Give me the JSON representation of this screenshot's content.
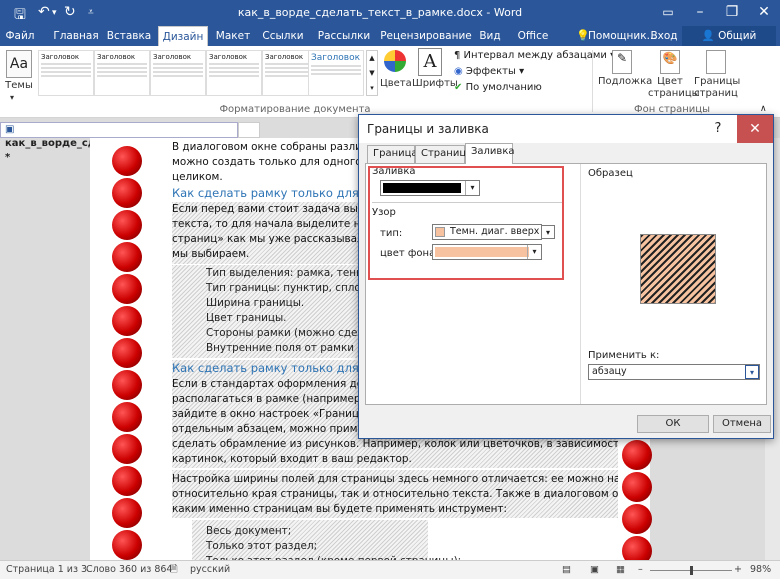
{
  "window": {
    "title": "как_в_ворде_сделать_текст_в_рамке.docx - Word"
  },
  "quick_access": {
    "save_icon": "save-icon",
    "undo_icon": "undo-icon",
    "redo_icon": "redo-icon"
  },
  "tabs": [
    "Файл",
    "Главная",
    "Вставка",
    "Дизайн",
    "Макет",
    "Ссылки",
    "Рассылки",
    "Рецензирование",
    "Вид",
    "Office Tab"
  ],
  "tab_active": "Дизайн",
  "tell_me": "Помощник...",
  "signin": "Вход",
  "share": "Общий доступ",
  "ribbon": {
    "themes_label": "Темы",
    "style_thumbs": [
      {
        "title": "Заголовок"
      },
      {
        "title": "Заголовок"
      },
      {
        "title": "Заголовок"
      },
      {
        "title": "Заголовок"
      },
      {
        "title": "Заголовок"
      },
      {
        "title": "Заголовок"
      }
    ],
    "colors_label": "Цвета",
    "fonts_label": "Шрифты",
    "paragraph_spacing": "Интервал между абзацами",
    "effects": "Эффекты",
    "set_default": "По умолчанию",
    "group_format": "Форматирование документа",
    "watermark": "Подложка",
    "page_color": "Цвет страницы",
    "page_borders": "Границы страниц",
    "group_background": "Фон страницы"
  },
  "document": {
    "tab_name": "как_в_ворде_сделать_текст_в_рамке.docx *",
    "lines": [
      "В диалоговом окне собраны различные ...",
      "можно создать только для одного абзаца",
      "целиком."
    ],
    "heading1": "Как сделать рамку только для конкре",
    "para2": [
      "Если перед вами стоит задача выделить",
      "текста, то для начала выделите необходи",
      "страниц» как мы уже рассказывали. Вс",
      "мы выбираем."
    ],
    "bullets1": [
      "Тип выделения: рамка, тень или",
      "Тип границы: пунктир, сплошна",
      "Ширина границы.",
      "Цвет границы.",
      "Стороны рамки (можно сделать",
      "Внутренние поля от рамки до т"
    ],
    "heading2": "Как сделать рамку только для одной",
    "para3": [
      "Если в стандартах оформления докуме",
      "располагаться в рамке (например, титу",
      "зайдите в окно настроек «Границы стра",
      "отдельным абзацем, можно применит",
      "сделать обрамление из рисунков. Например, колок или цветочков, в зависимости от выбора",
      "картинок, который входит в ваш редактор."
    ],
    "para4": [
      "Настройка ширины полей для страницы здесь немного отличается: ее можно настраивать как",
      "относительно края страницы, так и относительно текста. Также в диалоговом окне отметьте, к",
      "каким именно страницам вы будете применять инструмент:"
    ],
    "bullets2": [
      "Весь документ;",
      "Только этот раздел;",
      "Только этот раздел (кроме первой страницы);"
    ]
  },
  "dialog": {
    "title": "Границы и заливка",
    "help": "?",
    "tabs": [
      "Граница",
      "Страница",
      "Заливка"
    ],
    "active_tab": "Заливка",
    "fill_label": "Заливка",
    "fill_color": "#000000",
    "pattern_label": "Узор",
    "type_label": "тип:",
    "type_value": "Темн. диаг. вверх",
    "bg_label": "цвет фона:",
    "bg_color": "#f6c2a0",
    "preview_label": "Образец",
    "apply_label": "Применить к:",
    "apply_value": "абзацу",
    "ok": "ОК",
    "cancel": "Отмена"
  },
  "status": {
    "page": "Страница 1 из 3",
    "words": "Слово 360 из 864",
    "language": "русский",
    "zoom": "98%"
  }
}
